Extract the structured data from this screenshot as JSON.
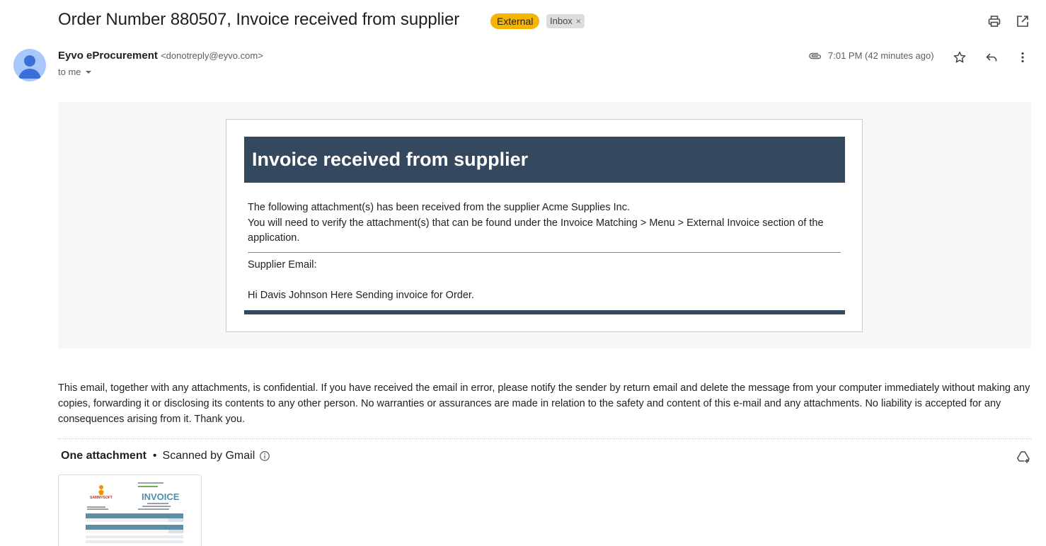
{
  "email": {
    "subject": "Order Number 880507, Invoice received from supplier",
    "labels": {
      "external": "External",
      "inbox": "Inbox",
      "inbox_remove": "×"
    },
    "sender_name": "Eyvo eProcurement",
    "sender_email": "<donotreply@eyvo.com>",
    "recipient": "to me",
    "time": "7:01 PM (42 minutes ago)"
  },
  "icons": {
    "header": [
      "print-icon",
      "open-in-new-window-icon"
    ],
    "meta": [
      "attachment-icon",
      "star-icon",
      "reply-icon",
      "more-vert-icon"
    ],
    "other": [
      "chevron-down-icon",
      "info-icon",
      "add-to-drive-icon"
    ]
  },
  "message": {
    "banner_title": "Invoice received from supplier",
    "line1": "The following attachment(s) has been received from the supplier Acme Supplies Inc.",
    "line2": "You will need to verify the attachment(s) that can be found under the Invoice Matching > Menu > External Invoice section of the application.",
    "supplier_email_label": "Supplier Email:",
    "supplier_message": "Hi Davis Johnson Here Sending invoice for Order."
  },
  "disclaimer": "This email, together with any attachments, is confidential. If you have received the email in error, please notify the sender by return email and delete the message from your computer immediately without making any copies, forwarding it or disclosing its contents to any other person. No warranties or assurances are made in relation to the safety and content of this e-mail and any attachments. No liability is accepted for any consequences arising from it. Thank you.",
  "attachments": {
    "count_label": "One attachment",
    "scan_label": "Scanned by Gmail",
    "preview_title": "INVOICE",
    "preview_brand": "SAMMYSOFT"
  },
  "colors": {
    "banner": "#34495e",
    "external_badge": "#f5b400",
    "inbox_badge": "#dddddd",
    "avatar_bg": "#a8c7fa",
    "avatar_fg": "#3a6fd8"
  }
}
